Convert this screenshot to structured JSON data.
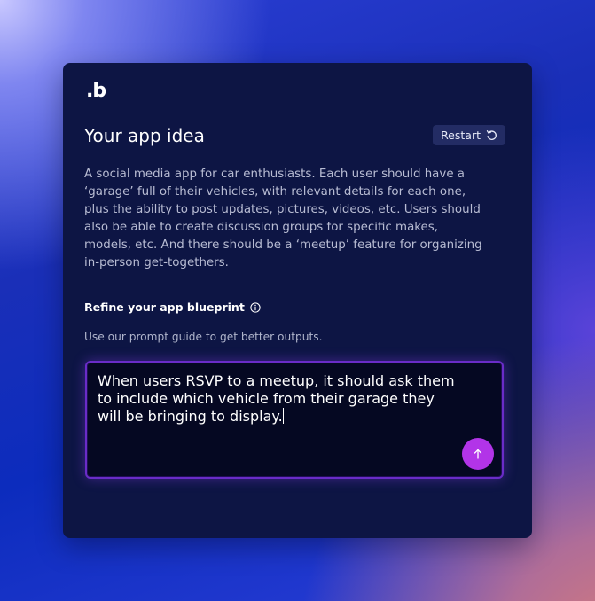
{
  "brand": {
    "logo_text": ".b"
  },
  "header": {
    "title": "Your app idea",
    "restart_label": "Restart"
  },
  "idea": {
    "description": "A social media app for car enthusiasts. Each user should have a ‘garage’ full of their vehicles, with relevant details for each one, plus the ability to post updates, pictures, videos, etc. Users should also be able to create discussion groups for specific makes, models, etc. And there should be a ‘meetup’ feature for organizing in-person get-togethers."
  },
  "refine": {
    "label": "Refine your app blueprint",
    "hint": "Use our prompt guide to get better outputs.",
    "input_value": "When users RSVP to a meetup, it should ask them to include which vehicle from their garage they will be bringing to display."
  },
  "icons": {
    "restart": "restart-icon",
    "info": "info-icon",
    "send": "arrow-up-icon"
  },
  "colors": {
    "card_bg": "#0d1544",
    "accent": "#b234e8",
    "input_border": "#6a2cc8"
  }
}
